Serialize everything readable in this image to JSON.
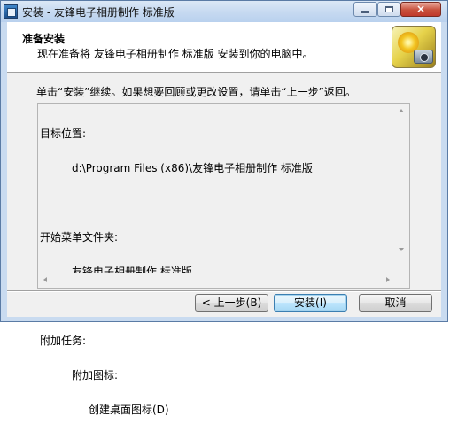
{
  "window": {
    "title": "安装 - 友锋电子相册制作 标准版",
    "close_label": "×"
  },
  "header": {
    "title": "准备安装",
    "subtitle": "现在准备将 友锋电子相册制作 标准版 安装到你的电脑中。",
    "logo_icon": "sunflower-camera-icon"
  },
  "instruction": "单击“安装”继续。如果想要回顾或更改设置，请单击“上一步”返回。",
  "summary": {
    "dest_label": "目标位置:",
    "dest_value": "d:\\Program Files (x86)\\友锋电子相册制作 标准版",
    "startmenu_label": "开始菜单文件夹:",
    "startmenu_value": "友锋电子相册制作 标准版",
    "tasks_label": "附加任务:",
    "tasks_group": "附加图标:",
    "tasks_item": "创建桌面图标(D)"
  },
  "buttons": {
    "back": "< 上一步(B)",
    "install": "安装(I)",
    "cancel": "取消"
  }
}
